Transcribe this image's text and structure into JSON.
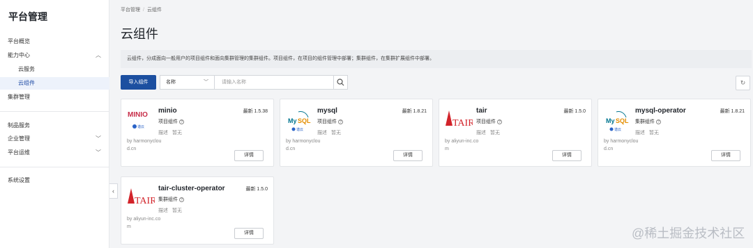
{
  "sidebar": {
    "title": "平台管理",
    "items": [
      {
        "label": "平台概览"
      },
      {
        "label": "能力中心",
        "chevron": "^"
      },
      {
        "label": "云服务"
      },
      {
        "label": "云组件"
      },
      {
        "label": "集群管理"
      },
      {
        "label": "制品服务"
      },
      {
        "label": "企业管理",
        "chevron": "v"
      },
      {
        "label": "平台运维",
        "chevron": "v"
      },
      {
        "label": "系统设置"
      }
    ]
  },
  "breadcrumb": [
    "平台管理",
    "云组件"
  ],
  "page_title": "云组件",
  "description": "云组件，分成面向一般用户的项目组件和面向集群管理的集群组件。项目组件，在项目的组件管理中部署；集群组件，在集群扩展组件中部署。",
  "toolbar": {
    "import_label": "导入组件",
    "select_value": "名称",
    "search_placeholder": "请输入名称"
  },
  "cards": [
    {
      "name": "minio",
      "version": "最新 1.5.38",
      "type": "项目组件",
      "desc_label": "描述",
      "desc_value": "暂无",
      "by": "by harmonycloud.cn",
      "detail": "详情",
      "logo": "minio-logo"
    },
    {
      "name": "mysql",
      "version": "最新 1.8.21",
      "type": "项目组件",
      "desc_label": "描述",
      "desc_value": "暂无",
      "by": "by harmonycloud.cn",
      "detail": "详情",
      "logo": "mysql-logo"
    },
    {
      "name": "tair",
      "version": "最新 1.5.0",
      "type": "项目组件",
      "desc_label": "描述",
      "desc_value": "暂无",
      "by": "by aliyun-inc.com",
      "detail": "详情",
      "logo": "tair-logo"
    },
    {
      "name": "mysql-operator",
      "version": "最新 1.8.21",
      "type": "集群组件",
      "desc_label": "描述",
      "desc_value": "暂无",
      "by": "by harmonycloud.cn",
      "detail": "详情",
      "logo": "mysql-logo"
    },
    {
      "name": "tair-cluster-operator",
      "version": "最新 1.5.0",
      "type": "集群组件",
      "desc_label": "描述",
      "desc_value": "暂无",
      "by": "by aliyun-inc.com",
      "detail": "详情",
      "logo": "tair-logo"
    }
  ],
  "watermark": "@稀土掘金技术社区",
  "colors": {
    "primary": "#1c4fa0",
    "active_bg": "#edf2fb",
    "tair_red": "#d2232a",
    "minio_red": "#c72e49",
    "mysql_blue": "#00758f"
  }
}
